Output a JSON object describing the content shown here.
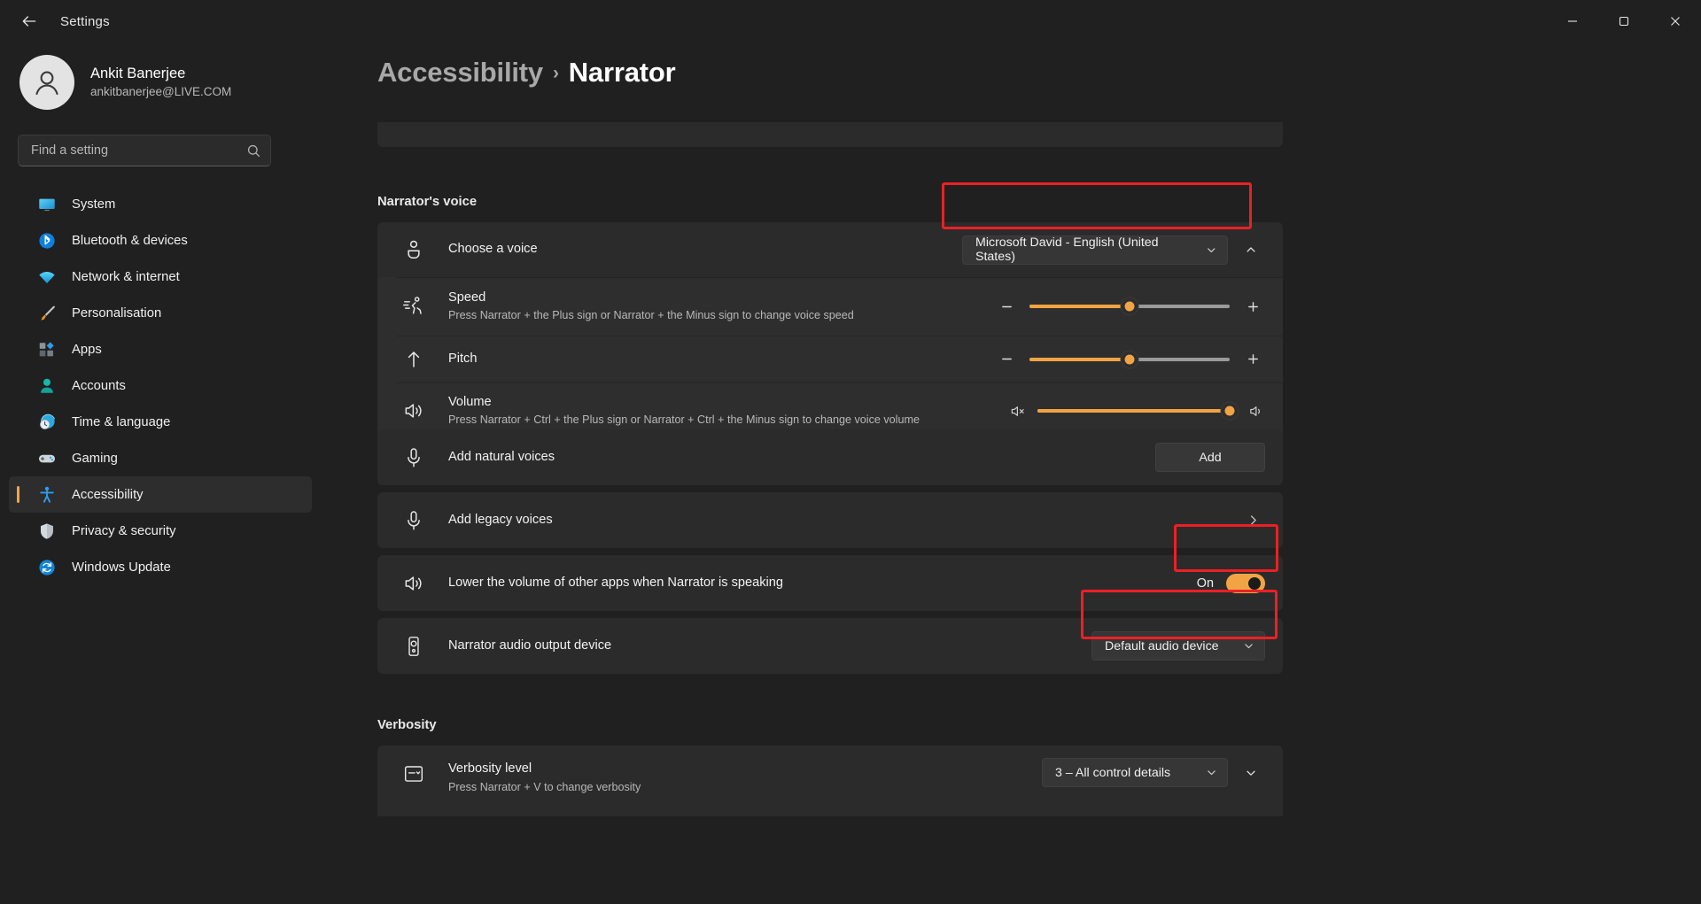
{
  "window": {
    "title": "Settings",
    "back_icon": "back-arrow-icon",
    "minimize_label": "–",
    "maximize_label": "☐",
    "close_label": "✕"
  },
  "account": {
    "name": "Ankit Banerjee",
    "email": "ankitbanerjee@LIVE.COM",
    "avatar_icon": "person-avatar-icon"
  },
  "search": {
    "placeholder": "Find a setting",
    "value": "",
    "icon": "search-icon"
  },
  "sidebar": {
    "items": [
      {
        "label": "System",
        "icon": "monitor-icon",
        "active": false
      },
      {
        "label": "Bluetooth & devices",
        "icon": "bluetooth-icon",
        "active": false
      },
      {
        "label": "Network & internet",
        "icon": "wifi-icon",
        "active": false
      },
      {
        "label": "Personalisation",
        "icon": "paintbrush-icon",
        "active": false
      },
      {
        "label": "Apps",
        "icon": "apps-icon",
        "active": false
      },
      {
        "label": "Accounts",
        "icon": "account-person-icon",
        "active": false
      },
      {
        "label": "Time & language",
        "icon": "clock-globe-icon",
        "active": false
      },
      {
        "label": "Gaming",
        "icon": "gamepad-icon",
        "active": false
      },
      {
        "label": "Accessibility",
        "icon": "accessibility-person-icon",
        "active": true
      },
      {
        "label": "Privacy & security",
        "icon": "shield-icon",
        "active": false
      },
      {
        "label": "Windows Update",
        "icon": "update-refresh-icon",
        "active": false
      }
    ]
  },
  "breadcrumb": {
    "parent": "Accessibility",
    "separator": "›",
    "current": "Narrator"
  },
  "sections": {
    "voice": {
      "heading": "Narrator's voice",
      "choose_voice": {
        "label": "Choose a voice",
        "icon": "voice-person-icon",
        "value": "Microsoft David - English (United States)",
        "chevron": "chevron-down-icon",
        "expander": "chevron-up-icon",
        "highlighted": true
      },
      "speed": {
        "label": "Speed",
        "description": "Press Narrator + the Plus sign or Narrator + the Minus sign to change voice speed",
        "icon": "running-person-icon",
        "minus": "–",
        "plus": "+",
        "percent": 50
      },
      "pitch": {
        "label": "Pitch",
        "description": "",
        "icon": "up-arrow-icon",
        "minus": "–",
        "plus": "+",
        "percent": 50
      },
      "volume": {
        "label": "Volume",
        "description": "Press Narrator + Ctrl + the Plus sign or Narrator + Ctrl + the Minus sign to change voice volume",
        "icon": "speaker-waves-icon",
        "mute_icon": "speaker-mute-icon",
        "max_icon": "speaker-on-icon",
        "percent": 96
      },
      "add_natural": {
        "label": "Add natural voices",
        "icon": "microphone-icon",
        "button": "Add"
      },
      "add_legacy": {
        "label": "Add legacy voices",
        "icon": "microphone-icon",
        "chevron": "chevron-right-icon"
      },
      "lower_volume": {
        "label": "Lower the volume of other apps when Narrator is speaking",
        "icon": "speaker-waves-icon",
        "state": "On",
        "enabled": true,
        "highlighted": true
      },
      "audio_device": {
        "label": "Narrator audio output device",
        "icon": "speaker-device-icon",
        "value": "Default audio device",
        "chevron": "chevron-down-icon",
        "highlighted": true
      }
    },
    "verbosity": {
      "heading": "Verbosity",
      "level": {
        "label": "Verbosity level",
        "description": "Press Narrator + V to change verbosity",
        "icon": "list-dropdown-icon",
        "value": "3  – All control details",
        "chevron": "chevron-down-icon",
        "expander": "chevron-down-icon"
      }
    }
  },
  "colors": {
    "accent": "#f2a444",
    "annotation": "#ec2024",
    "background": "#202020",
    "card": "#2b2b2b"
  }
}
